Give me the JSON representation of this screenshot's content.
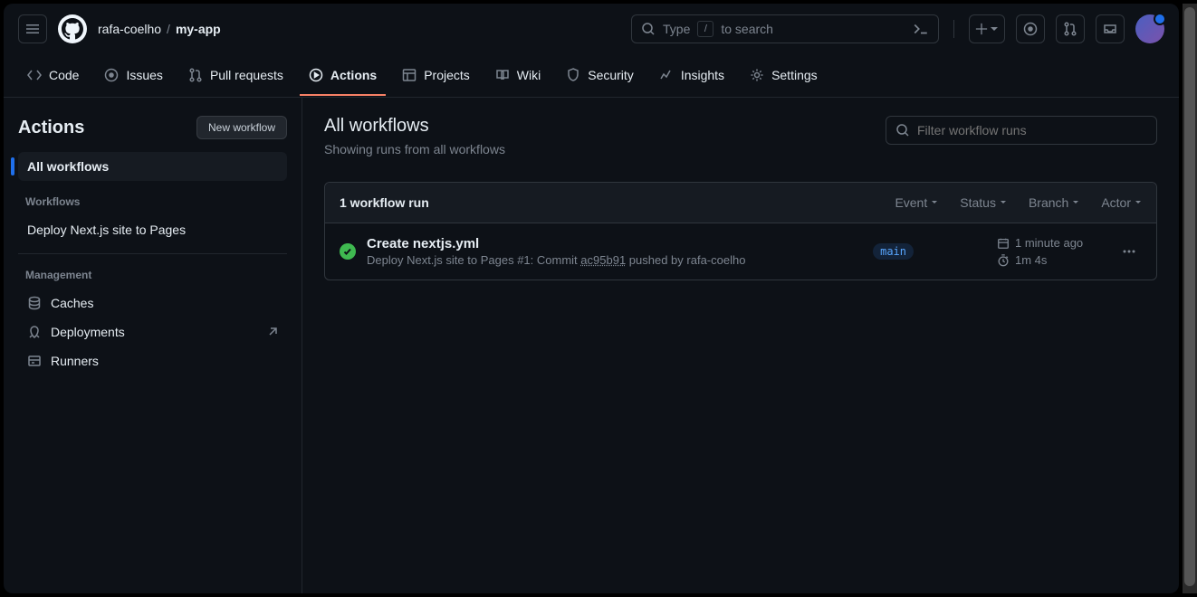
{
  "header": {
    "owner": "rafa-coelho",
    "repo": "my-app",
    "search_prefix": "Type",
    "search_key": "/",
    "search_suffix": "to search"
  },
  "tabs": [
    {
      "label": "Code",
      "icon": "code-icon"
    },
    {
      "label": "Issues",
      "icon": "issues-icon"
    },
    {
      "label": "Pull requests",
      "icon": "pr-icon"
    },
    {
      "label": "Actions",
      "icon": "actions-icon",
      "active": true
    },
    {
      "label": "Projects",
      "icon": "projects-icon"
    },
    {
      "label": "Wiki",
      "icon": "wiki-icon"
    },
    {
      "label": "Security",
      "icon": "security-icon"
    },
    {
      "label": "Insights",
      "icon": "insights-icon"
    },
    {
      "label": "Settings",
      "icon": "settings-icon"
    }
  ],
  "sidebar": {
    "title": "Actions",
    "new_button": "New workflow",
    "all_workflows": "All workflows",
    "workflows_heading": "Workflows",
    "workflows": [
      "Deploy Next.js site to Pages"
    ],
    "management_heading": "Management",
    "management": [
      {
        "label": "Caches",
        "icon": "caches-icon"
      },
      {
        "label": "Deployments",
        "icon": "deployments-icon",
        "external": true
      },
      {
        "label": "Runners",
        "icon": "runners-icon"
      }
    ]
  },
  "content": {
    "title": "All workflows",
    "subtitle": "Showing runs from all workflows",
    "filter_placeholder": "Filter workflow runs"
  },
  "runs": {
    "count_label": "1 workflow run",
    "filters": [
      "Event",
      "Status",
      "Branch",
      "Actor"
    ],
    "items": [
      {
        "status": "success",
        "title": "Create nextjs.yml",
        "workflow": "Deploy Next.js site to Pages",
        "run_number": "#1",
        "sub_prefix": ": Commit ",
        "commit": "ac95b91",
        "sub_middle": " pushed by ",
        "actor": "rafa-coelho",
        "branch": "main",
        "time": "1 minute ago",
        "duration": "1m 4s"
      }
    ]
  }
}
